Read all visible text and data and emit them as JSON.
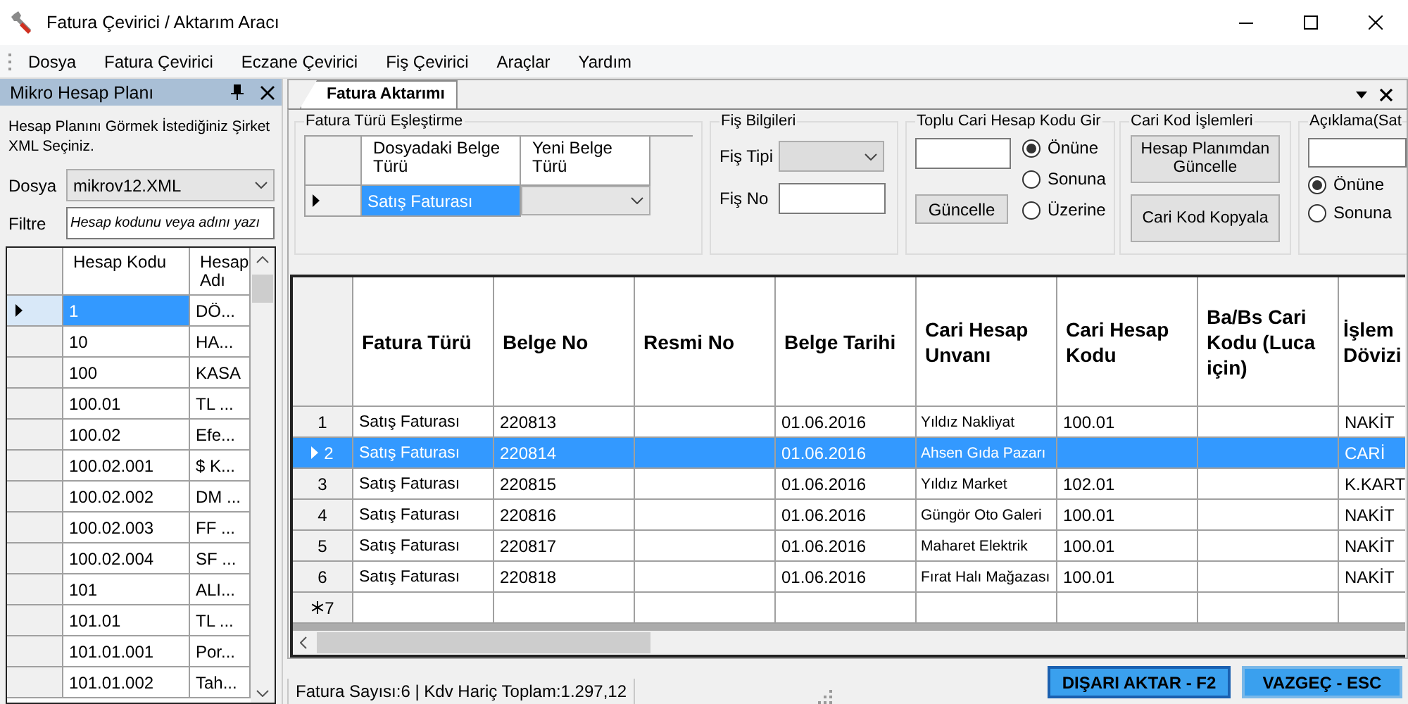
{
  "window": {
    "title": "Fatura Çevirici / Aktarım Aracı"
  },
  "menu": [
    "Dosya",
    "Fatura Çevirici",
    "Eczane Çevirici",
    "Fiş Çevirici",
    "Araçlar",
    "Yardım"
  ],
  "side_panel": {
    "title": "Mikro Hesap Planı",
    "instruction": "Hesap Planını Görmek İstediğiniz Şirket XML Seçiniz.",
    "file_label": "Dosya",
    "file_value": "mikrov12.XML",
    "filter_label": "Filtre",
    "filter_placeholder": "Hesap kodunu veya adını yazı",
    "columns": [
      "Hesap Kodu",
      "Hesap Adı"
    ],
    "rows": [
      {
        "code": "1",
        "name": "DÖ...",
        "selected": true
      },
      {
        "code": "10",
        "name": "HA...",
        "selected": false
      },
      {
        "code": "100",
        "name": "KASA",
        "selected": false
      },
      {
        "code": "100.01",
        "name": "TL ...",
        "selected": false
      },
      {
        "code": "100.02",
        "name": "Efe...",
        "selected": false
      },
      {
        "code": "100.02.001",
        "name": "$ K...",
        "selected": false
      },
      {
        "code": "100.02.002",
        "name": "DM ...",
        "selected": false
      },
      {
        "code": "100.02.003",
        "name": "FF ...",
        "selected": false
      },
      {
        "code": "100.02.004",
        "name": "SF ...",
        "selected": false
      },
      {
        "code": "101",
        "name": "ALI...",
        "selected": false
      },
      {
        "code": "101.01",
        "name": "TL ...",
        "selected": false
      },
      {
        "code": "101.01.001",
        "name": "Por...",
        "selected": false
      },
      {
        "code": "101.01.002",
        "name": "Tah...",
        "selected": false
      }
    ]
  },
  "tabs": [
    {
      "label": "Fatura Aktarımı",
      "selected": true
    }
  ],
  "type_mapping": {
    "title": "Fatura Türü Eşleştirme",
    "columns": [
      "Dosyadaki Belge Türü",
      "Yeni Belge Türü"
    ],
    "rows": [
      {
        "source": "Satış Faturası",
        "selected": true
      }
    ]
  },
  "slip_info": {
    "title": "Fiş Bilgileri",
    "type_label": "Fiş Tipi",
    "no_label": "Fiş No"
  },
  "bulk_code": {
    "title": "Toplu Cari Hesap Kodu Gir",
    "button": "Güncelle",
    "options": [
      {
        "label": "Önüne",
        "selected": true
      },
      {
        "label": "Sonuna",
        "selected": false
      },
      {
        "label": "Üzerine",
        "selected": false
      }
    ]
  },
  "code_ops": {
    "title": "Cari Kod İşlemleri",
    "buttons": [
      "Hesap Planımdan Güncelle",
      "Cari Kod Kopyala"
    ]
  },
  "description": {
    "title": "Açıklama(Sat",
    "options": [
      {
        "label": "Önüne",
        "selected": true
      },
      {
        "label": "Sonuna",
        "selected": false
      }
    ]
  },
  "invoices": {
    "columns": [
      "Fatura Türü",
      "Belge No",
      "Resmi No",
      "Belge Tarihi",
      "Cari Hesap Unvanı",
      "Cari Hesap Kodu",
      "Ba/Bs Cari Kodu (Luca için)",
      "İşlem Dövizi"
    ],
    "rows": [
      {
        "number": "1",
        "selected": false,
        "cells": [
          "Satış Faturası",
          "220813",
          "",
          "01.06.2016",
          "Yıldız Nakliyat",
          "100.01",
          "",
          "NAKİT"
        ]
      },
      {
        "number": "2",
        "selected": true,
        "cells": [
          "Satış Faturası",
          "220814",
          "",
          "01.06.2016",
          "Ahsen Gıda Pazarı",
          "",
          "",
          "CARİ"
        ]
      },
      {
        "number": "3",
        "selected": false,
        "cells": [
          "Satış Faturası",
          "220815",
          "",
          "01.06.2016",
          "Yıldız Market",
          "102.01",
          "",
          "K.KART"
        ]
      },
      {
        "number": "4",
        "selected": false,
        "cells": [
          "Satış Faturası",
          "220816",
          "",
          "01.06.2016",
          "Güngör Oto Galeri",
          "100.01",
          "",
          "NAKİT"
        ]
      },
      {
        "number": "5",
        "selected": false,
        "cells": [
          "Satış Faturası",
          "220817",
          "",
          "01.06.2016",
          "Maharet Elektrik",
          "100.01",
          "",
          "NAKİT"
        ]
      },
      {
        "number": "6",
        "selected": false,
        "cells": [
          "Satış Faturası",
          "220818",
          "",
          "01.06.2016",
          "Fırat Halı Mağazası",
          "100.01",
          "",
          "NAKİT"
        ]
      }
    ],
    "new_row": "7"
  },
  "status": "Fatura Sayısı:6 | Kdv Hariç Toplam:1.297,12",
  "buttons": [
    "DIŞARI AKTAR - F2",
    "VAZGEÇ - ESC"
  ]
}
